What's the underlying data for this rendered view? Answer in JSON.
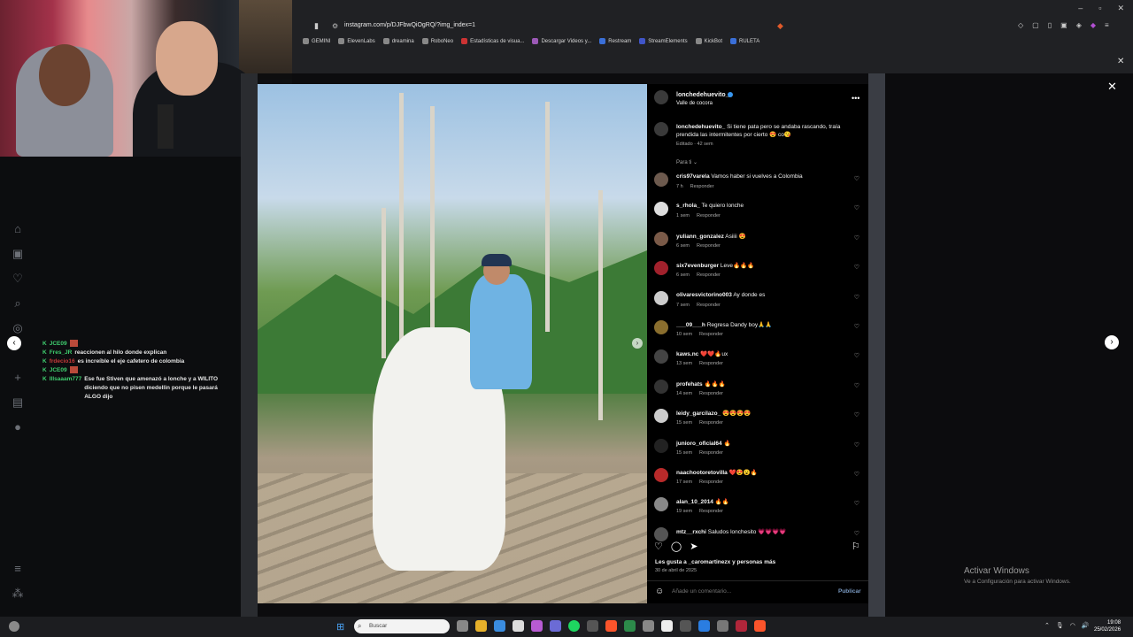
{
  "browser": {
    "url": "instagram.com/p/DJFbwQiOgRQ/?img_index=1",
    "bookmarks": [
      "GEMINI",
      "ElevenLabs",
      "dreamina",
      "RoboNeo",
      "Estadísticas de visua...",
      "Descargar Videos y...",
      "Restream",
      "StreamElements",
      "KickBot",
      "RULETA"
    ]
  },
  "chat": {
    "lines": [
      {
        "user": "JCE09",
        "msg": "",
        "user_color": "green"
      },
      {
        "user": "Fres_JR",
        "msg": "reaccionen al hilo donde explican",
        "user_color": "green"
      },
      {
        "user": "frdecio16",
        "msg": "es increíble el eje cafetero de colombia",
        "user_color": "red"
      },
      {
        "user": "JCE09",
        "msg": "",
        "user_color": "green"
      },
      {
        "user": "lIlsaaam777",
        "msg": "Ese fue Stiven que amenazó a lonche y a WILITO diciendo que no pisen medellin porque le pasará ALGO dijo",
        "user_color": "green"
      }
    ]
  },
  "post": {
    "username": "lonchedehuevito_",
    "location": "Valle de cocora",
    "caption_user": "lonchedehuevito_",
    "caption": "Si tiene pata pero se andaba rascando, traía prendida las intermitentes por cierto 😍 co😘",
    "caption_meta": "Editado · 42 sem",
    "for_you": "Para ti ⌄",
    "likes": "Les gusta a _caromartinezx y personas más",
    "date": "30 de abril de 2025",
    "comment_placeholder": "Añade un comentario...",
    "publish": "Publicar"
  },
  "comments": [
    {
      "user": "cris97varela",
      "text": "Vamos haber si vuelves a Colombia",
      "time": "7 h",
      "reply": "Responder"
    },
    {
      "user": "s_rhola_",
      "text": "Te quiero lonche",
      "time": "1 sem",
      "reply": "Responder"
    },
    {
      "user": "yuliann_gonzalez",
      "text": "Asiiii 😍",
      "time": "6 sem",
      "reply": "Responder"
    },
    {
      "user": "six7evenburger",
      "text": "Leve🔥🔥🔥",
      "time": "6 sem",
      "reply": "Responder"
    },
    {
      "user": "olivaresvictorino003",
      "text": "Ay donde es",
      "time": "7 sem",
      "reply": "Responder"
    },
    {
      "user": "___09___h",
      "text": "Regresa Dandy boy🙏🙏",
      "time": "10 sem",
      "reply": "Responder"
    },
    {
      "user": "kaws.nc",
      "text": "❤️❤️🔥ux",
      "time": "13 sem",
      "reply": "Responder"
    },
    {
      "user": "profehats",
      "text": "🔥🔥🔥",
      "time": "14 sem",
      "reply": "Responder"
    },
    {
      "user": "leidy_garcilazo_",
      "text": "😍😍😍😍",
      "time": "15 sem",
      "reply": "Responder"
    },
    {
      "user": "junioro_oficial64",
      "text": "🔥",
      "time": "15 sem",
      "reply": "Responder"
    },
    {
      "user": "naachootoretovilla",
      "text": "❤️😍😮🔥",
      "time": "17 sem",
      "reply": "Responder"
    },
    {
      "user": "alan_10_2014",
      "text": "🔥🔥",
      "time": "19 sem",
      "reply": "Responder"
    },
    {
      "user": "mtz__rxchi",
      "text": "Saludos lonchesito 💗💗💗💗",
      "time": "",
      "reply": ""
    }
  ],
  "system": {
    "activate_title": "Activar Windows",
    "activate_sub": "Ve a Configuración para activar Windows.",
    "search": "Buscar",
    "time": "19:08",
    "date": "25/02/2026"
  },
  "icons": {
    "heart": "heart-icon",
    "comment": "comment-icon",
    "share": "share-icon",
    "save": "bookmark-icon"
  }
}
